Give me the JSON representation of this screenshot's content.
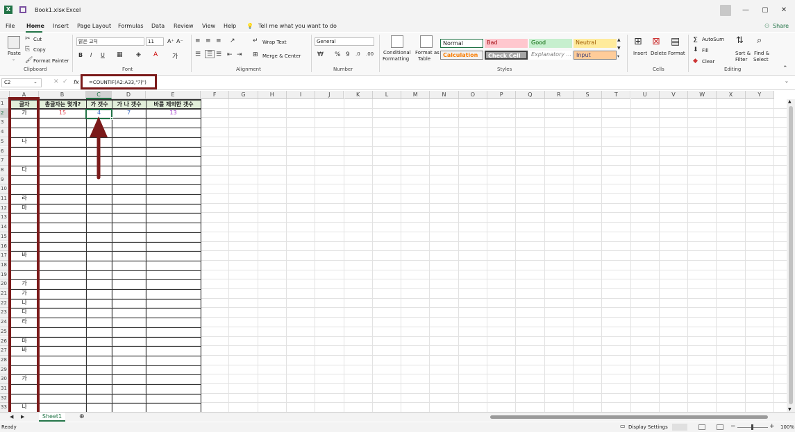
{
  "titlebar": {
    "filename": "Book1.xlsx",
    "separator": "-",
    "app": "Excel"
  },
  "menu": {
    "items": [
      "File",
      "Home",
      "Insert",
      "Page Layout",
      "Formulas",
      "Data",
      "Review",
      "View",
      "Help"
    ],
    "tellme": "Tell me what you want to do",
    "share": "Share"
  },
  "ribbon": {
    "clipboard": {
      "paste": "Paste",
      "cut": "Cut",
      "copy": "Copy",
      "format_painter": "Format Painter",
      "label": "Clipboard"
    },
    "font": {
      "name": "맑은 고딕",
      "size": "11",
      "bold": "B",
      "italic": "I",
      "underline": "U",
      "label": "Font"
    },
    "alignment": {
      "wrap": "Wrap Text",
      "merge": "Merge & Center",
      "label": "Alignment"
    },
    "number": {
      "format": "General",
      "percent": "%",
      "comma": "9",
      "label": "Number"
    },
    "styles": {
      "conditional_1": "Conditional",
      "conditional_2": "Formatting",
      "table_1": "Format as",
      "table_2": "Table",
      "normal": "Normal",
      "bad": "Bad",
      "good": "Good",
      "neutral": "Neutral",
      "calculation": "Calculation",
      "check": "Check Cell",
      "explanatory": "Explanatory ...",
      "input": "Input",
      "label": "Styles"
    },
    "cells": {
      "insert": "Insert",
      "delete": "Delete",
      "format": "Format",
      "label": "Cells"
    },
    "editing": {
      "autosum": "AutoSum",
      "fill": "Fill",
      "clear": "Clear",
      "sort_1": "Sort &",
      "sort_2": "Filter",
      "find_1": "Find &",
      "find_2": "Select",
      "label": "Editing"
    }
  },
  "formula_bar": {
    "name_box": "C2",
    "fx": "fx",
    "formula": "=COUNTIF(A2:A33,\"가\")"
  },
  "columns": [
    "A",
    "B",
    "C",
    "D",
    "E",
    "F",
    "G",
    "H",
    "I",
    "J",
    "K",
    "L",
    "M",
    "N",
    "O",
    "P",
    "Q",
    "R",
    "S",
    "T",
    "U",
    "V",
    "W",
    "X",
    "Y"
  ],
  "rows": [
    "1",
    "2",
    "3",
    "4",
    "5",
    "6",
    "7",
    "8",
    "9",
    "10",
    "11",
    "12",
    "13",
    "14",
    "15",
    "16",
    "17",
    "18",
    "19",
    "20",
    "21",
    "22",
    "23",
    "24",
    "25",
    "26",
    "27",
    "28",
    "29",
    "30",
    "31",
    "32",
    "33"
  ],
  "header_row": {
    "A": "글자",
    "B": "총글자는 몇개?",
    "C": "가 갯수",
    "D": "가 나 갯수",
    "E": "바를 제외한 갯수"
  },
  "values_row2": {
    "B": "15",
    "C": "4",
    "D": "7",
    "E": "13"
  },
  "column_a": [
    {
      "row": 2,
      "v": "가"
    },
    {
      "row": 5,
      "v": "나"
    },
    {
      "row": 8,
      "v": "다"
    },
    {
      "row": 11,
      "v": "라"
    },
    {
      "row": 12,
      "v": "마"
    },
    {
      "row": 17,
      "v": "바"
    },
    {
      "row": 20,
      "v": "가"
    },
    {
      "row": 21,
      "v": "가"
    },
    {
      "row": 22,
      "v": "나"
    },
    {
      "row": 23,
      "v": "다"
    },
    {
      "row": 24,
      "v": "라"
    },
    {
      "row": 26,
      "v": "마"
    },
    {
      "row": 27,
      "v": "바"
    },
    {
      "row": 30,
      "v": "가"
    },
    {
      "row": 33,
      "v": "나"
    }
  ],
  "sheet_tab": "Sheet1",
  "status": {
    "ready": "Ready",
    "display_settings": "Display Settings",
    "zoom": "100%"
  },
  "colors": {
    "excel_green": "#217346",
    "highlight": "#7b1a1a",
    "header_fill": "#e2efda",
    "b_value": "#e0404a",
    "c_value": "#4472c4",
    "e_value": "#9b30c8"
  },
  "annotations": {
    "arrow": "arrow-pointing-up-to-C2"
  }
}
